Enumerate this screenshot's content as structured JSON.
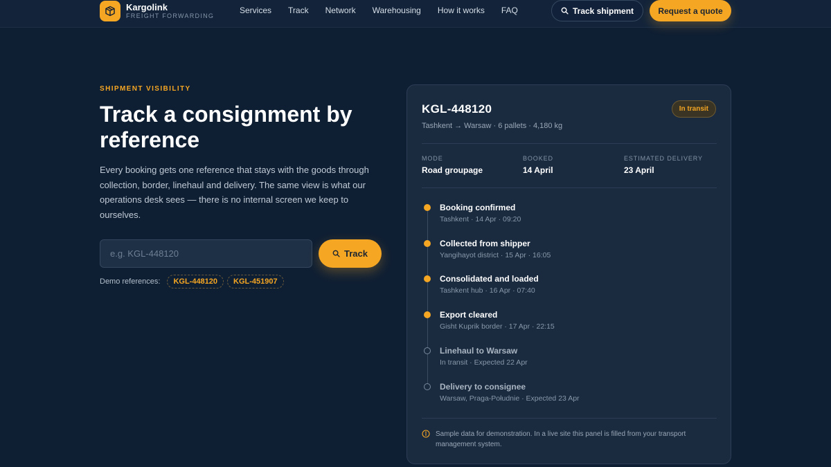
{
  "header": {
    "brand_name": "Kargolink",
    "brand_sub": "FREIGHT FORWARDING",
    "nav": [
      "Services",
      "Track",
      "Network",
      "Warehousing",
      "How it works",
      "FAQ"
    ],
    "track_button": "Track shipment",
    "quote_button": "Request a quote"
  },
  "hero": {
    "eyebrow": "SHIPMENT VISIBILITY",
    "title": "Track a consignment by reference",
    "body": "Every booking gets one reference that stays with the goods through collection, border, linehaul and delivery. The same view is what our operations desk sees — there is no internal screen we keep to ourselves.",
    "input_placeholder": "e.g. KGL-448120",
    "input_value": "",
    "track_button": "Track",
    "demo_label": "Demo references:",
    "demo_refs": [
      "KGL-448120",
      "KGL-451907"
    ]
  },
  "card": {
    "reference": "KGL-448120",
    "route": "Tashkent → Warsaw · 6 pallets · 4,180 kg",
    "status": "In transit",
    "meta": [
      {
        "label": "MODE",
        "value": "Road groupage"
      },
      {
        "label": "BOOKED",
        "value": "14 April"
      },
      {
        "label": "ESTIMATED DELIVERY",
        "value": "23 April"
      }
    ],
    "events": [
      {
        "title": "Booking confirmed",
        "detail": "Tashkent · 14 Apr · 09:20",
        "state": "done"
      },
      {
        "title": "Collected from shipper",
        "detail": "Yangihayot district · 15 Apr · 16:05",
        "state": "done"
      },
      {
        "title": "Consolidated and loaded",
        "detail": "Tashkent hub · 16 Apr · 07:40",
        "state": "done"
      },
      {
        "title": "Export cleared",
        "detail": "Gisht Kuprik border · 17 Apr · 22:15",
        "state": "done"
      },
      {
        "title": "Linehaul to Warsaw",
        "detail": "In transit · Expected 22 Apr",
        "state": "pending"
      },
      {
        "title": "Delivery to consignee",
        "detail": "Warsaw, Praga-Południe · Expected 23 Apr",
        "state": "pending"
      }
    ],
    "note": "Sample data for demonstration. In a live site this panel is filled from your transport management system."
  },
  "colors": {
    "accent": "#f5a623",
    "background": "#0f1f33",
    "card": "#1a2b40"
  },
  "icons": {
    "brand": "package-icon",
    "search": "search-icon",
    "info": "info-icon"
  }
}
